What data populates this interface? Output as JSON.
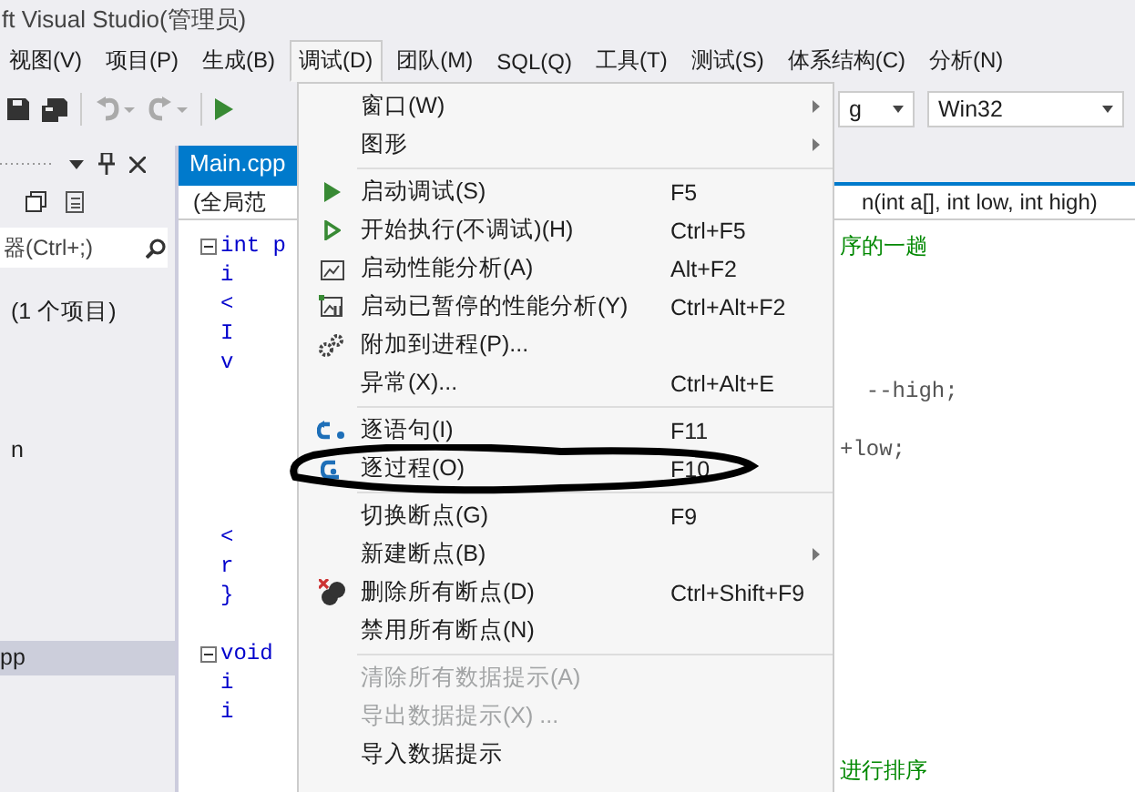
{
  "window": {
    "title": "ft Visual Studio(管理员)"
  },
  "menu_bar": [
    {
      "label": "视图(V)",
      "selected": false
    },
    {
      "label": "项目(P)",
      "selected": false
    },
    {
      "label": "生成(B)",
      "selected": false
    },
    {
      "label": "调试(D)",
      "selected": true
    },
    {
      "label": "团队(M)",
      "selected": false
    },
    {
      "label": "SQL(Q)",
      "selected": false
    },
    {
      "label": "工具(T)",
      "selected": false
    },
    {
      "label": "测试(S)",
      "selected": false
    },
    {
      "label": "体系结构(C)",
      "selected": false
    },
    {
      "label": "分析(N)",
      "selected": false
    }
  ],
  "toolbar": {
    "configuration": "g",
    "platform": "Win32"
  },
  "solution_panel": {
    "search_placeholder": "器(Ctrl+;)",
    "items": [
      {
        "label": "(1 个项目)",
        "selected": false
      },
      {
        "label": "n",
        "selected": false
      },
      {
        "label": "pp",
        "selected": true
      }
    ]
  },
  "editor": {
    "tab": "Main.cpp",
    "scope": "(全局范",
    "member": "n(int a[], int low, int high)",
    "lines": [
      {
        "fold": true,
        "left": "int p",
        "right": "序的一趟",
        "kind": "comment"
      },
      {
        "fold": false,
        "left": "i"
      },
      {
        "fold": false,
        "left": "<"
      },
      {
        "fold": false,
        "left": "I"
      },
      {
        "fold": false,
        "left": "v"
      },
      {
        "fold": false,
        "right": "  --high;",
        "kind": "code"
      },
      {
        "fold": false
      },
      {
        "fold": false,
        "right": "+low;",
        "kind": "code"
      },
      {
        "fold": false
      },
      {
        "fold": false
      },
      {
        "fold": false,
        "left": "<"
      },
      {
        "fold": false,
        "left": "r"
      },
      {
        "fold": false,
        "left": "}"
      },
      {
        "fold": false
      },
      {
        "fold": true,
        "left": "void"
      },
      {
        "fold": false,
        "left": "i"
      },
      {
        "fold": false,
        "left": "i"
      },
      {
        "fold": false
      },
      {
        "fold": false,
        "right": "进行排序",
        "kind": "comment"
      }
    ]
  },
  "debug_menu": {
    "groups": [
      [
        {
          "label": "窗口(W)",
          "submenu": true,
          "disabled": false
        },
        {
          "label": "图形",
          "submenu": true,
          "disabled": false
        }
      ],
      [
        {
          "label": "启动调试(S)",
          "shortcut": "F5",
          "submenu": false,
          "disabled": false
        },
        {
          "label": "开始执行(不调试)(H)",
          "shortcut": "Ctrl+F5",
          "submenu": false,
          "disabled": false
        },
        {
          "label": "启动性能分析(A)",
          "shortcut": "Alt+F2",
          "submenu": false,
          "disabled": false
        },
        {
          "label": "启动已暂停的性能分析(Y)",
          "shortcut": "Ctrl+Alt+F2",
          "submenu": false,
          "disabled": false
        },
        {
          "label": "附加到进程(P)...",
          "submenu": false,
          "disabled": false
        },
        {
          "label": "异常(X)...",
          "shortcut": "Ctrl+Alt+E",
          "submenu": false,
          "disabled": false
        }
      ],
      [
        {
          "label": "逐语句(I)",
          "shortcut": "F11",
          "submenu": false,
          "disabled": false
        },
        {
          "label": "逐过程(O)",
          "shortcut": "F10",
          "submenu": false,
          "disabled": false,
          "circled": true
        }
      ],
      [
        {
          "label": "切换断点(G)",
          "shortcut": "F9",
          "submenu": false,
          "disabled": false
        },
        {
          "label": "新建断点(B)",
          "submenu": true,
          "disabled": false
        },
        {
          "label": "删除所有断点(D)",
          "shortcut": "Ctrl+Shift+F9",
          "submenu": false,
          "disabled": false
        },
        {
          "label": "禁用所有断点(N)",
          "submenu": false,
          "disabled": false
        }
      ],
      [
        {
          "label": "清除所有数据提示(A)",
          "submenu": false,
          "disabled": true
        },
        {
          "label": "导出数据提示(X) ...",
          "submenu": false,
          "disabled": true
        },
        {
          "label": "导入数据提示",
          "submenu": false,
          "disabled": false
        }
      ]
    ]
  }
}
